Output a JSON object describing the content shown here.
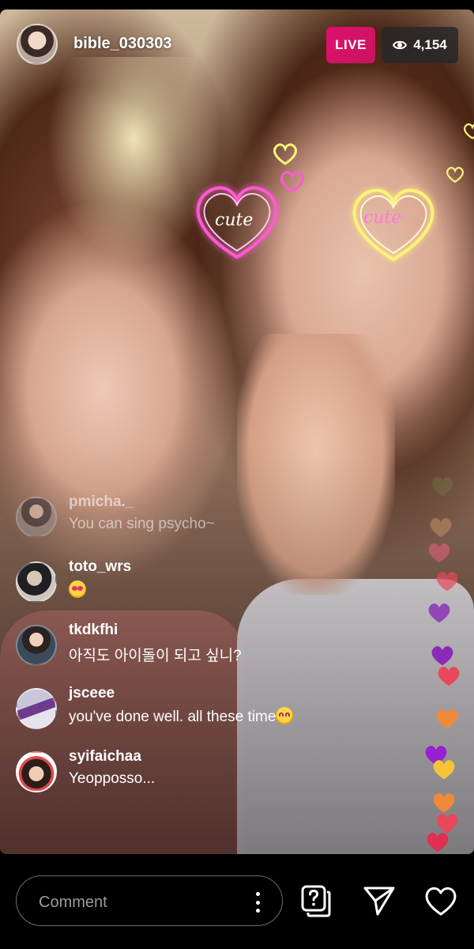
{
  "header": {
    "username": "bible_030303",
    "live_label": "LIVE",
    "viewer_count": "4,154",
    "avatar_icon": "profile-avatar-icon",
    "viewers_icon": "eye-icon"
  },
  "effects": {
    "heart_text_left": "cute",
    "heart_text_right": "cute"
  },
  "comments": [
    {
      "username": "pmicha._",
      "message": "You can sing psycho~",
      "faded": true
    },
    {
      "username": "toto_wrs",
      "message": "",
      "emoji": "heart-eyes-emoji"
    },
    {
      "username": "tkdkfhi",
      "message": "아직도 아이돌이 되고 싶니?"
    },
    {
      "username": "jsceee",
      "message": "you've done well. all these time",
      "emoji": "smiling-emoji"
    },
    {
      "username": "syifaichaa",
      "message": "Yeopposso..."
    }
  ],
  "footer": {
    "comment_placeholder": "Comment",
    "icons": [
      "more-options-icon",
      "question-sticker-icon",
      "send-icon",
      "like-heart-icon"
    ]
  },
  "colors": {
    "live": "#d8136a",
    "neon_pink": "#ff5ad2",
    "neon_yellow": "#fff27a",
    "heart_colors": [
      "#f0a040",
      "#e8485a",
      "#8a2bb8",
      "#f6c23a",
      "#f2845a"
    ]
  }
}
